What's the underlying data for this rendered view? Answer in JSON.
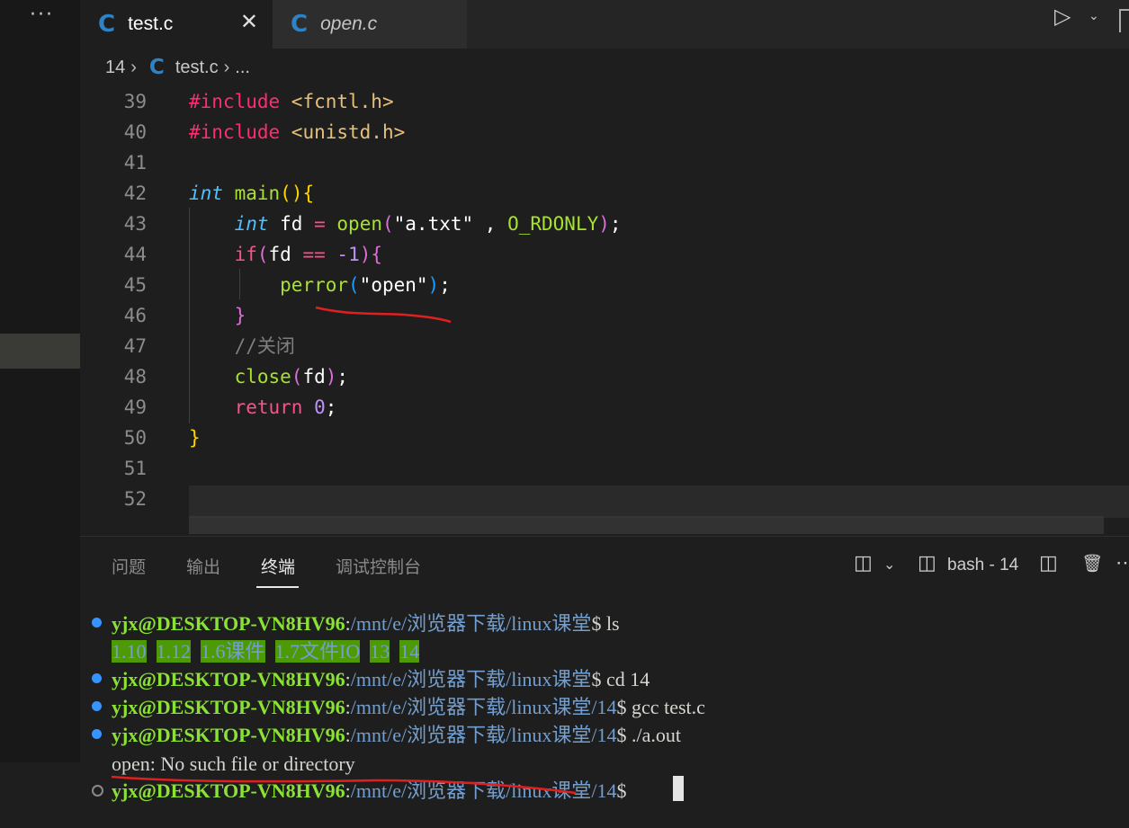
{
  "window": {
    "more_label": "···",
    "tabs": [
      {
        "icon": "C",
        "label": "test.c",
        "active": true,
        "close": "✕"
      },
      {
        "icon": "C",
        "label": "open.c",
        "active": false
      }
    ],
    "run_icon": "▷",
    "run_chevron": "⌄"
  },
  "breadcrumb": {
    "folder": "14",
    "sep": "›",
    "icon": "C",
    "file": "test.c",
    "tail": "..."
  },
  "editor": {
    "lines": [
      {
        "n": "39",
        "parts": [
          {
            "t": "#include ",
            "c": "kw-inc"
          },
          {
            "t": "<fcntl.h>",
            "c": "hdr"
          }
        ]
      },
      {
        "n": "40",
        "parts": [
          {
            "t": "#include ",
            "c": "kw-inc"
          },
          {
            "t": "<unistd.h>",
            "c": "hdr"
          }
        ]
      },
      {
        "n": "41",
        "parts": []
      },
      {
        "n": "42",
        "parts": [
          {
            "t": "int",
            "c": "type"
          },
          {
            "t": " ",
            "c": "plain"
          },
          {
            "t": "main",
            "c": "fn"
          },
          {
            "t": "()",
            "c": "b1"
          },
          {
            "t": "{",
            "c": "b1"
          }
        ]
      },
      {
        "n": "43",
        "parts": [
          {
            "t": "    ",
            "c": "plain"
          },
          {
            "t": "int",
            "c": "type"
          },
          {
            "t": " fd ",
            "c": "plain"
          },
          {
            "t": "=",
            "c": "op"
          },
          {
            "t": " ",
            "c": "plain"
          },
          {
            "t": "open",
            "c": "fn"
          },
          {
            "t": "(",
            "c": "b2"
          },
          {
            "t": "\"a.txt\"",
            "c": "str"
          },
          {
            "t": " , ",
            "c": "plain"
          },
          {
            "t": "O_RDONLY",
            "c": "fn"
          },
          {
            "t": ")",
            "c": "b2"
          },
          {
            "t": ";",
            "c": "plain"
          }
        ]
      },
      {
        "n": "44",
        "parts": [
          {
            "t": "    ",
            "c": "plain"
          },
          {
            "t": "if",
            "c": "ctrl"
          },
          {
            "t": "(",
            "c": "b2"
          },
          {
            "t": "fd ",
            "c": "plain"
          },
          {
            "t": "==",
            "c": "op"
          },
          {
            "t": " ",
            "c": "plain"
          },
          {
            "t": "-1",
            "c": "num"
          },
          {
            "t": ")",
            "c": "b2"
          },
          {
            "t": "{",
            "c": "b2"
          }
        ]
      },
      {
        "n": "45",
        "parts": [
          {
            "t": "        ",
            "c": "plain"
          },
          {
            "t": "perror",
            "c": "fn"
          },
          {
            "t": "(",
            "c": "b3"
          },
          {
            "t": "\"open\"",
            "c": "str"
          },
          {
            "t": ")",
            "c": "b3"
          },
          {
            "t": ";",
            "c": "plain"
          }
        ]
      },
      {
        "n": "46",
        "parts": [
          {
            "t": "    ",
            "c": "plain"
          },
          {
            "t": "}",
            "c": "b2"
          }
        ]
      },
      {
        "n": "47",
        "parts": [
          {
            "t": "    ",
            "c": "plain"
          },
          {
            "t": "//关闭",
            "c": "comment"
          }
        ]
      },
      {
        "n": "48",
        "parts": [
          {
            "t": "    ",
            "c": "plain"
          },
          {
            "t": "close",
            "c": "fn"
          },
          {
            "t": "(",
            "c": "b2"
          },
          {
            "t": "fd",
            "c": "plain"
          },
          {
            "t": ")",
            "c": "b2"
          },
          {
            "t": ";",
            "c": "plain"
          }
        ]
      },
      {
        "n": "49",
        "parts": [
          {
            "t": "    ",
            "c": "plain"
          },
          {
            "t": "return",
            "c": "ctrl"
          },
          {
            "t": " ",
            "c": "plain"
          },
          {
            "t": "0",
            "c": "num"
          },
          {
            "t": ";",
            "c": "plain"
          }
        ]
      },
      {
        "n": "50",
        "parts": [
          {
            "t": "}",
            "c": "b1"
          }
        ]
      },
      {
        "n": "51",
        "parts": []
      },
      {
        "n": "52",
        "parts": []
      }
    ]
  },
  "panel": {
    "tabs": [
      "问题",
      "输出",
      "终端",
      "调试控制台"
    ],
    "active_tab": "终端",
    "bash_label": "bash - 14",
    "split_icon": "◫",
    "chevron": "⌄",
    "trash_icon": "🗑",
    "more": "⋯"
  },
  "terminal": {
    "lines": [
      {
        "dot": "blue",
        "parts": [
          {
            "t": "yjx@DESKTOP-VN8HV96",
            "c": "user"
          },
          {
            "t": ":",
            "c": "cmd"
          },
          {
            "t": "/mnt/e/浏览器下载/linux课堂",
            "c": "path"
          },
          {
            "t": "$ ls",
            "c": "cmd"
          }
        ]
      },
      {
        "dot": "none",
        "parts": [
          {
            "t": "1.10",
            "c": "dirhl"
          },
          {
            "t": "  ",
            "c": "cmd"
          },
          {
            "t": "1.12",
            "c": "dirhl"
          },
          {
            "t": "  ",
            "c": "cmd"
          },
          {
            "t": "1.6课件",
            "c": "dirhl"
          },
          {
            "t": "  ",
            "c": "cmd"
          },
          {
            "t": "1.7文件IO",
            "c": "dirhl"
          },
          {
            "t": "  ",
            "c": "cmd"
          },
          {
            "t": "13",
            "c": "dirhl"
          },
          {
            "t": "  ",
            "c": "cmd"
          },
          {
            "t": "14",
            "c": "dirhl"
          }
        ]
      },
      {
        "dot": "blue",
        "parts": [
          {
            "t": "yjx@DESKTOP-VN8HV96",
            "c": "user"
          },
          {
            "t": ":",
            "c": "cmd"
          },
          {
            "t": "/mnt/e/浏览器下载/linux课堂",
            "c": "path"
          },
          {
            "t": "$ cd 14",
            "c": "cmd"
          }
        ]
      },
      {
        "dot": "blue",
        "parts": [
          {
            "t": "yjx@DESKTOP-VN8HV96",
            "c": "user"
          },
          {
            "t": ":",
            "c": "cmd"
          },
          {
            "t": "/mnt/e/浏览器下载/linux课堂/14",
            "c": "path"
          },
          {
            "t": "$ gcc test.c",
            "c": "cmd"
          }
        ]
      },
      {
        "dot": "blue",
        "parts": [
          {
            "t": "yjx@DESKTOP-VN8HV96",
            "c": "user"
          },
          {
            "t": ":",
            "c": "cmd"
          },
          {
            "t": "/mnt/e/浏览器下载/linux课堂/14",
            "c": "path"
          },
          {
            "t": "$ ./a.out",
            "c": "cmd"
          }
        ]
      },
      {
        "dot": "none",
        "parts": [
          {
            "t": "open: No such file or directory",
            "c": "cmd"
          }
        ]
      },
      {
        "dot": "empty",
        "parts": [
          {
            "t": "yjx@DESKTOP-VN8HV96",
            "c": "user"
          },
          {
            "t": ":",
            "c": "cmd"
          },
          {
            "t": "/mnt/e/浏览器下载/linux课堂/14",
            "c": "path"
          },
          {
            "t": "$ ",
            "c": "cmd"
          }
        ]
      }
    ]
  },
  "colors": {
    "accent": "#3794ff",
    "annotation": "#e02020"
  }
}
